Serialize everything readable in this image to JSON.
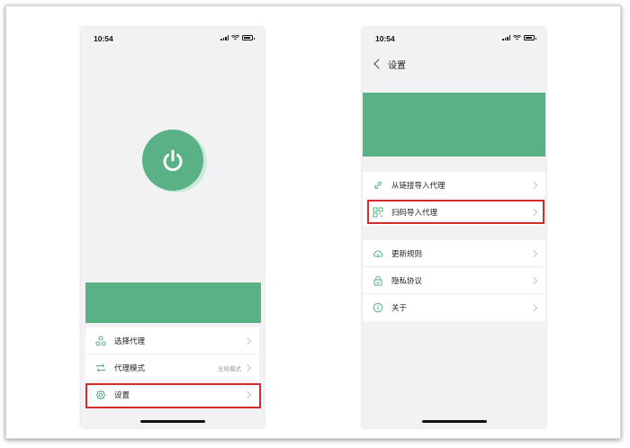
{
  "left_screen": {
    "status_time": "10:54",
    "menu": [
      {
        "label": "选择代理",
        "value": "",
        "icon": "nodes-icon"
      },
      {
        "label": "代理模式",
        "value": "全局模式",
        "icon": "repeat-arrows-icon"
      },
      {
        "label": "设置",
        "value": "",
        "icon": "gear-icon"
      }
    ]
  },
  "right_screen": {
    "status_time": "10:54",
    "nav_title": "设置",
    "group1": [
      {
        "label": "从链接导入代理",
        "icon": "link-icon"
      },
      {
        "label": "扫码导入代理",
        "icon": "qr-code-icon"
      }
    ],
    "group2": [
      {
        "label": "更新规则",
        "icon": "cloud-icon"
      },
      {
        "label": "隐私协议",
        "icon": "lock-icon"
      },
      {
        "label": "关于",
        "icon": "info-icon"
      }
    ]
  },
  "colors": {
    "accent_green": "#5ab185",
    "highlight_red": "#d12b2b"
  }
}
